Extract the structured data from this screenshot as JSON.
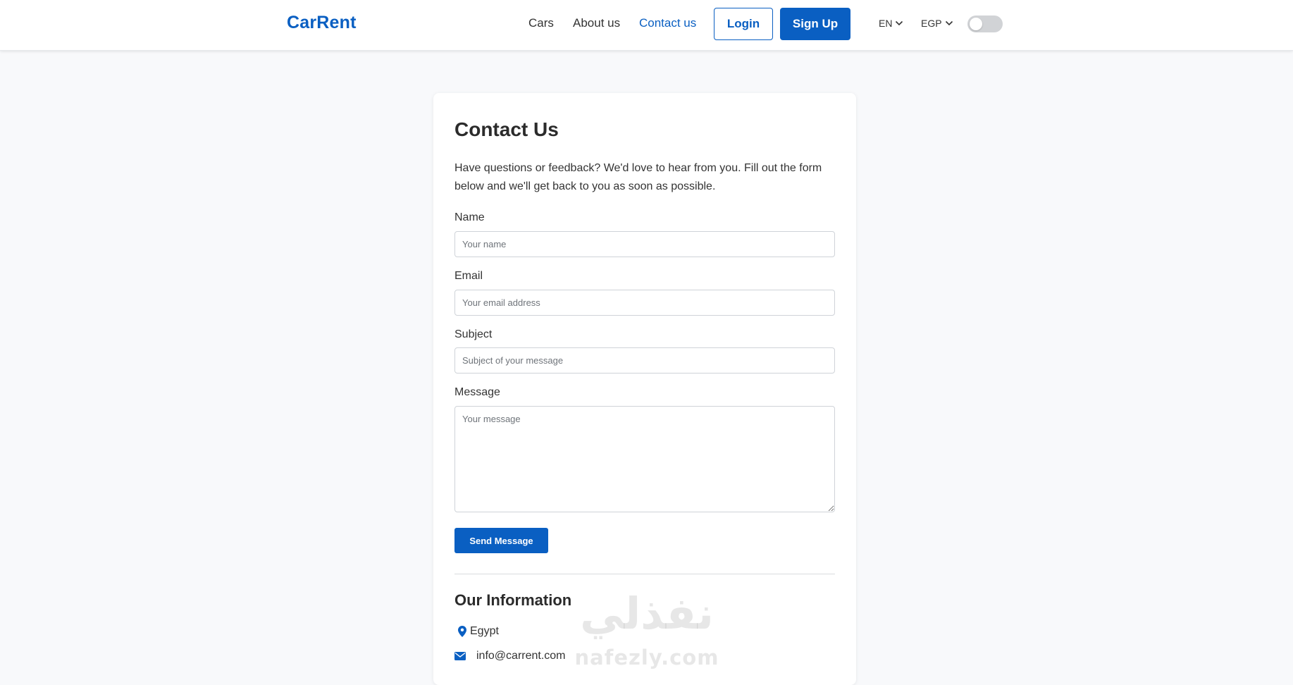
{
  "brand": {
    "name": "CarRent",
    "accent_color": "#0a5fc2"
  },
  "nav": {
    "links": [
      {
        "label": "Cars",
        "active": false
      },
      {
        "label": "About us",
        "active": false
      },
      {
        "label": "Contact us",
        "active": true
      }
    ],
    "login_label": "Login",
    "signup_label": "Sign Up",
    "language": {
      "selected": "EN",
      "icon": "chevron-down-icon"
    },
    "currency": {
      "selected": "EGP",
      "icon": "chevron-down-icon"
    },
    "theme_toggle": {
      "on": false
    }
  },
  "contact": {
    "title": "Contact Us",
    "intro": "Have questions or feedback? We'd love to hear from you. Fill out the form below and we'll get back to you as soon as possible.",
    "fields": {
      "name": {
        "label": "Name",
        "placeholder": "Your name",
        "value": ""
      },
      "email": {
        "label": "Email",
        "placeholder": "Your email address",
        "value": ""
      },
      "subject": {
        "label": "Subject",
        "placeholder": "Subject of your message",
        "value": ""
      },
      "message": {
        "label": "Message",
        "placeholder": "Your message",
        "value": ""
      }
    },
    "submit_label": "Send Message"
  },
  "info": {
    "title": "Our Information",
    "location": {
      "text": "Egypt",
      "icon": "map-pin-icon"
    },
    "email": {
      "text": "info@carrent.com",
      "icon": "envelope-icon"
    }
  },
  "watermark": {
    "arabic": "نفذلي",
    "latin": "nafezly.com"
  }
}
